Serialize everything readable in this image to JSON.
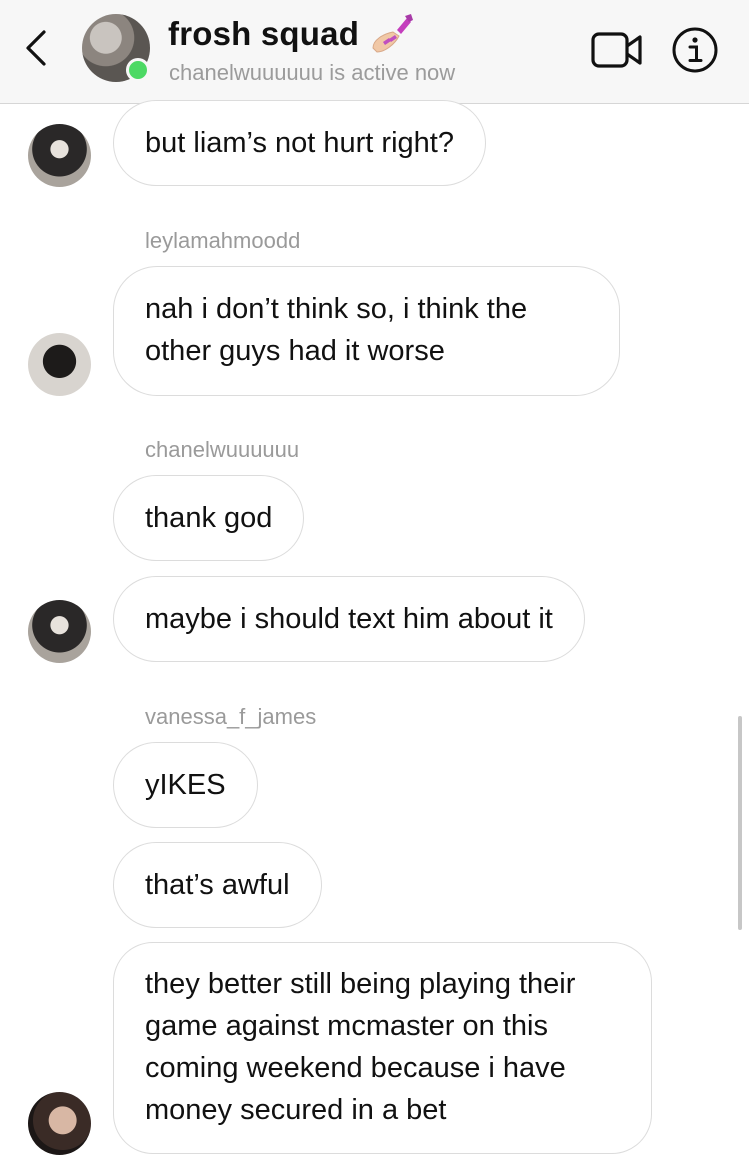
{
  "header": {
    "title": "frosh squad",
    "title_emoji": "nail-polish-icon",
    "status": "chanelwuuuuuu is active now",
    "active_color": "#4cd964"
  },
  "messages": [
    {
      "sender": "",
      "text": "but liam’s not hurt right?"
    },
    {
      "sender": "leylamahmoodd",
      "text": "nah i don’t think so, i think the other guys had it worse"
    },
    {
      "sender": "chanelwuuuuuu",
      "text": "thank god"
    },
    {
      "sender": "",
      "text": "maybe i should text him about it"
    },
    {
      "sender": "vanessa_f_james",
      "text": "yIKES"
    },
    {
      "sender": "",
      "text": "that’s awful"
    },
    {
      "sender": "",
      "text": "they better still being playing their game against mcmaster on this coming weekend because i have money secured in a bet"
    }
  ]
}
